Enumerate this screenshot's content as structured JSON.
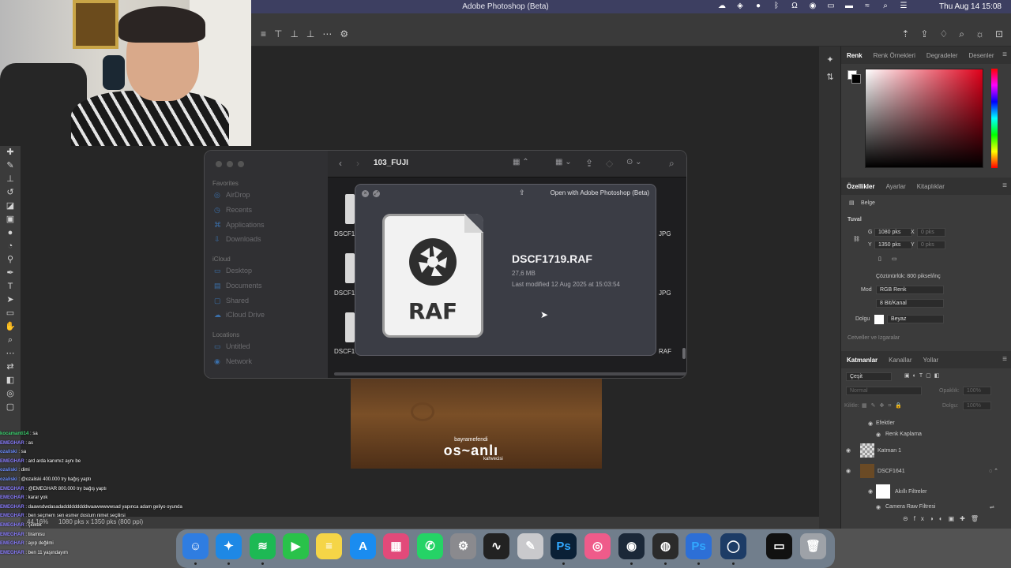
{
  "menubar": {
    "app_title": "Adobe Photoshop (Beta)",
    "clock": "Thu Aug 14  15:08",
    "status_icons": [
      "creative-cloud-icon",
      "compass-icon",
      "circle-icon",
      "bluetooth-icon",
      "headphones-icon",
      "record-icon",
      "display-icon",
      "battery-icon",
      "wifi-icon",
      "search-icon",
      "control-center-icon",
      "siri-icon"
    ]
  },
  "optionsbar": {
    "left_icons": [
      "≡",
      "⊥",
      "⊥",
      "⊥",
      "⋯",
      "⚙"
    ],
    "right_icons": [
      "⌂",
      "⇪",
      "♢",
      "⌕",
      "☼",
      "⊡"
    ]
  },
  "chat": [
    {
      "user": "kocamanti14",
      "text": ": sa",
      "color": "#3bd16f"
    },
    {
      "user": "EMEGHAR",
      "text": ": as",
      "color": "#8a7dff"
    },
    {
      "user": "ozaliski",
      "text": ": sa",
      "color": "#6a8cff"
    },
    {
      "user": "EMEGHAR",
      "text": ": ard arda kanımız aynı be",
      "color": "#8a7dff"
    },
    {
      "user": "ozaliski",
      "text": ": dimi",
      "color": "#6a8cff"
    },
    {
      "user": "ozaliski",
      "text": ": @ozaliski 400.000 try bağış yaptı",
      "color": "#6a8cff"
    },
    {
      "user": "EMEGHAR",
      "text": ": @EMEGHAR 800.000 try bağış yaptı",
      "color": "#8a7dff"
    },
    {
      "user": "EMEGHAR",
      "text": ": karar yok",
      "color": "#8a7dff"
    },
    {
      "user": "EMEGHAR",
      "text": ": daawsdwdasadadddddddddwaawwwwwsad yapınca adam geliyo oyunda",
      "color": "#8a7dff"
    },
    {
      "user": "EMEGHAR",
      "text": ": ben seçmem sen esmer dostum nimet seçilirsi",
      "color": "#8a7dff"
    },
    {
      "user": "EMEGHAR",
      "text": ": çiokek",
      "color": "#8a7dff"
    },
    {
      "user": "EMEGHAR",
      "text": ": tiramisu",
      "color": "#8a7dff"
    },
    {
      "user": "EMEGHAR",
      "text": ": ayıp değilmi",
      "color": "#8a7dff"
    },
    {
      "user": "EMEGHAR",
      "text": ": ben 11 yaşındayım",
      "color": "#8a7dff"
    }
  ],
  "statusbar": {
    "zoom": "44,16%",
    "doc_info": "1080 pks x 1350 pks (800 ppi)"
  },
  "finder": {
    "folder_title": "103_FUJI",
    "sidebar": {
      "favorites_label": "Favorites",
      "favorites": [
        "AirDrop",
        "Recents",
        "Applications",
        "Downloads"
      ],
      "icloud_label": "iCloud",
      "icloud": [
        "Desktop",
        "Documents",
        "Shared",
        "iCloud Drive"
      ],
      "locations_label": "Locations",
      "locations": [
        "Untitled",
        "Network"
      ]
    },
    "file_labels_left": [
      "DSCF1",
      "DSCF1",
      "DSCF1"
    ],
    "file_labels_right": [
      "JPG",
      "JPG",
      "RAF"
    ]
  },
  "quicklook": {
    "open_with_label": "Open with Adobe Photoshop (Beta)",
    "file_name": "DSCF1719.RAF",
    "file_size": "27,6 MB",
    "modified": "Last modified 12 Aug 2025 at 15:03:54",
    "icon_ext": "RAF"
  },
  "canvas": {
    "brand_top": "bayramefendi",
    "brand_name": "os~anlı",
    "brand_bottom": "kahvecisi"
  },
  "color_panel": {
    "tabs": [
      "Renk",
      "Renk Örnekleri",
      "Degradeler",
      "Desenler"
    ],
    "active_tab": "Renk"
  },
  "properties_panel": {
    "tabs": [
      "Özellikler",
      "Ayarlar",
      "Kitaplıklar"
    ],
    "doc_type": "Belge",
    "section": "Tuval",
    "width_label": "G",
    "width_value": "1080 pks",
    "x_label": "X",
    "x_placeholder": "0 pks",
    "height_label": "Y",
    "height_value": "1350 pks",
    "y_label": "Y",
    "y_placeholder": "0 pks",
    "resolution": "Çözünürlük: 800 piksel/inç",
    "mode_label": "Mod",
    "mode_value": "RGB Renk",
    "depth_value": "8 Bit/Kanal",
    "fill_label": "Dolgu",
    "fill_value": "Beyaz",
    "collapsed_section": "Cetveller ve Izgaralar"
  },
  "layers_panel": {
    "tabs": [
      "Katmanlar",
      "Kanallar",
      "Yollar"
    ],
    "filter_label": "Çeşit",
    "blend_mode": "Normal",
    "opacity_label": "Opaklık:",
    "opacity_value": "100%",
    "lock_label": "Kilitle:",
    "fill_label": "Dolgu:",
    "fill_value": "100%",
    "layers": [
      {
        "name": "Efektler",
        "indent": 1
      },
      {
        "name": "Renk Kaplama",
        "indent": 2
      },
      {
        "name": "Katman 1",
        "indent": 0
      },
      {
        "name": "DSCF1641",
        "indent": 0
      },
      {
        "name": "Akıllı Filtreler",
        "indent": 1
      },
      {
        "name": "Camera Raw Filtresi",
        "indent": 2
      }
    ]
  },
  "dock": {
    "apps": [
      {
        "name": "finder",
        "glyph": "☺",
        "color": "#2f7de1"
      },
      {
        "name": "safari",
        "glyph": "✦",
        "color": "#1e88e5"
      },
      {
        "name": "spotify",
        "glyph": "≋",
        "color": "#1db954"
      },
      {
        "name": "facetime",
        "glyph": "▶",
        "color": "#29c24a"
      },
      {
        "name": "notes",
        "glyph": "≡",
        "color": "#f5d547"
      },
      {
        "name": "appstore",
        "glyph": "A",
        "color": "#1a8cf0"
      },
      {
        "name": "launchpad",
        "glyph": "▦",
        "color": "#e24a7a"
      },
      {
        "name": "whatsapp",
        "glyph": "✆",
        "color": "#25d366"
      },
      {
        "name": "settings",
        "glyph": "⚙",
        "color": "#8a8a8e"
      },
      {
        "name": "activity-monitor",
        "glyph": "∿",
        "color": "#222"
      },
      {
        "name": "pencil-app",
        "glyph": "✎",
        "color": "#c9c9cc"
      },
      {
        "name": "photoshop",
        "glyph": "Ps",
        "color": "#0a2036"
      },
      {
        "name": "browser",
        "glyph": "◎",
        "color": "#ef5b8a"
      },
      {
        "name": "steam",
        "glyph": "◉",
        "color": "#1b2838"
      },
      {
        "name": "obs",
        "glyph": "◍",
        "color": "#2b2b2b"
      },
      {
        "name": "photoshop-beta",
        "glyph": "Ps",
        "color": "#2d6fd6"
      },
      {
        "name": "circle-app",
        "glyph": "◯",
        "color": "#1d3c66"
      },
      {
        "name": "screen-recorder",
        "glyph": "▭",
        "color": "#111"
      },
      {
        "name": "trash",
        "glyph": "🗑",
        "color": "#9ea2a8"
      }
    ]
  },
  "colors": {
    "menubar": "#3d3f61",
    "ps_bg": "#535353",
    "panel": "#3b3b3b",
    "accent": "#e0001a"
  }
}
